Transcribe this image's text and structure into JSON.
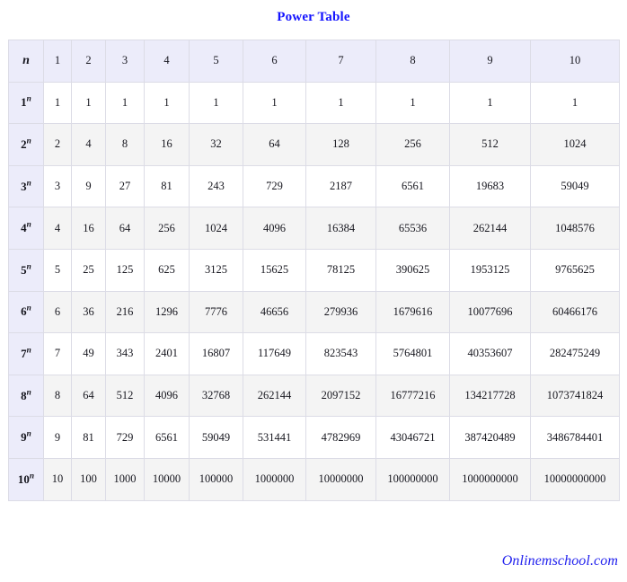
{
  "title": "Power Table",
  "footer": "Onlinemschool.com",
  "colors": {
    "title": "#1414ff",
    "footer": "#2222ee",
    "header_bg": "#ececfa",
    "rowhead_bg": "#ececfa",
    "stripe_bg": "#f4f4f4",
    "row_bg": "#ffffff",
    "border": "#dcdce6",
    "text": "#17171f"
  },
  "table": {
    "corner_label": "n",
    "exponent_symbol": "n",
    "column_headers": [
      "n",
      "1",
      "2",
      "3",
      "4",
      "5",
      "6",
      "7",
      "8",
      "9",
      "10"
    ],
    "row_labels": [
      "1",
      "2",
      "3",
      "4",
      "5",
      "6",
      "7",
      "8",
      "9",
      "10"
    ],
    "rows": [
      {
        "base": "1",
        "label_base": "1",
        "values": [
          "1",
          "1",
          "1",
          "1",
          "1",
          "1",
          "1",
          "1",
          "1",
          "1"
        ]
      },
      {
        "base": "2",
        "label_base": "2",
        "values": [
          "2",
          "4",
          "8",
          "16",
          "32",
          "64",
          "128",
          "256",
          "512",
          "1024"
        ]
      },
      {
        "base": "3",
        "label_base": "3",
        "values": [
          "3",
          "9",
          "27",
          "81",
          "243",
          "729",
          "2187",
          "6561",
          "19683",
          "59049"
        ]
      },
      {
        "base": "4",
        "label_base": "4",
        "values": [
          "4",
          "16",
          "64",
          "256",
          "1024",
          "4096",
          "16384",
          "65536",
          "262144",
          "1048576"
        ]
      },
      {
        "base": "5",
        "label_base": "5",
        "values": [
          "5",
          "25",
          "125",
          "625",
          "3125",
          "15625",
          "78125",
          "390625",
          "1953125",
          "9765625"
        ]
      },
      {
        "base": "6",
        "label_base": "6",
        "values": [
          "6",
          "36",
          "216",
          "1296",
          "7776",
          "46656",
          "279936",
          "1679616",
          "10077696",
          "60466176"
        ]
      },
      {
        "base": "7",
        "label_base": "7",
        "values": [
          "7",
          "49",
          "343",
          "2401",
          "16807",
          "117649",
          "823543",
          "5764801",
          "40353607",
          "282475249"
        ]
      },
      {
        "base": "8",
        "label_base": "8",
        "values": [
          "8",
          "64",
          "512",
          "4096",
          "32768",
          "262144",
          "2097152",
          "16777216",
          "134217728",
          "1073741824"
        ]
      },
      {
        "base": "9",
        "label_base": "9",
        "values": [
          "9",
          "81",
          "729",
          "6561",
          "59049",
          "531441",
          "4782969",
          "43046721",
          "387420489",
          "3486784401"
        ]
      },
      {
        "base": "10",
        "label_base": "10",
        "values": [
          "10",
          "100",
          "1000",
          "10000",
          "100000",
          "1000000",
          "10000000",
          "100000000",
          "1000000000",
          "10000000000"
        ]
      }
    ]
  }
}
